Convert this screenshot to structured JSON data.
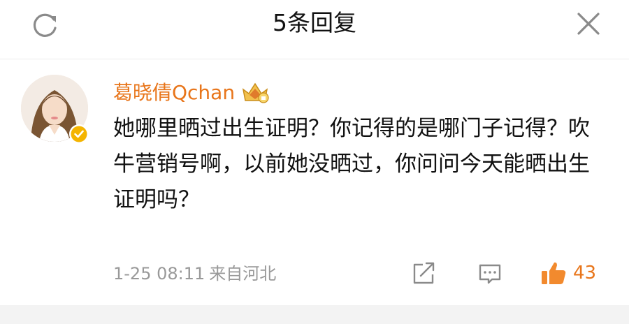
{
  "header": {
    "title": "5条回复"
  },
  "comment": {
    "username": "葛晓倩Qchan",
    "text": "她哪里晒过出生证明？你记得的是哪门子记得？吹牛营销号啊，以前她没晒过，你问问今天能晒出生证明吗？",
    "date": "1-25 08:11",
    "source": "来自河北",
    "likes": "43"
  },
  "icons": {
    "refresh": "refresh-icon",
    "close": "close-icon",
    "verified": "verified-badge-icon",
    "member": "crown-member-icon",
    "share": "share-icon",
    "comment": "comment-icon",
    "like": "thumbs-up-icon"
  },
  "colors": {
    "accent": "#e8751a",
    "meta": "#999999",
    "badge": "#f4b400"
  }
}
